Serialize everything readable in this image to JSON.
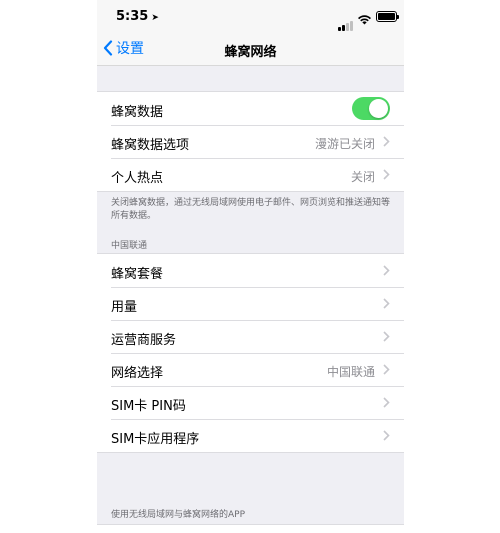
{
  "status_bar": {
    "time": "5:35",
    "location_arrow": "➤",
    "signal_bars": 2,
    "signal_total": 4,
    "battery_level": 1.0
  },
  "nav": {
    "back_label": "设置",
    "title": "蜂窝网络"
  },
  "group1": {
    "cellular_data": {
      "label": "蜂窝数据",
      "enabled": true
    },
    "cellular_options": {
      "label": "蜂窝数据选项",
      "value": "漫游已关闭"
    },
    "hotspot": {
      "label": "个人热点",
      "value": "关闭"
    }
  },
  "footnote": "关闭蜂窝数据，通过无线局域网使用电子邮件、网页浏览和推送通知等所有数据。",
  "carrier_section": {
    "header": "中国联通",
    "rows": {
      "plan": {
        "label": "蜂窝套餐"
      },
      "usage": {
        "label": "用量"
      },
      "carrier_services": {
        "label": "运营商服务"
      },
      "network_selection": {
        "label": "网络选择",
        "value": "中国联通"
      },
      "sim_pin": {
        "label": "SIM卡 PIN码"
      },
      "sim_apps": {
        "label": "SIM卡应用程序"
      }
    }
  },
  "apps_section": {
    "header": "使用无线局域网与蜂窝网络的APP"
  },
  "colors": {
    "accent": "#007aff",
    "toggle_on": "#4cd964",
    "background": "#efeff4",
    "secondary_text": "#8e8e93"
  }
}
